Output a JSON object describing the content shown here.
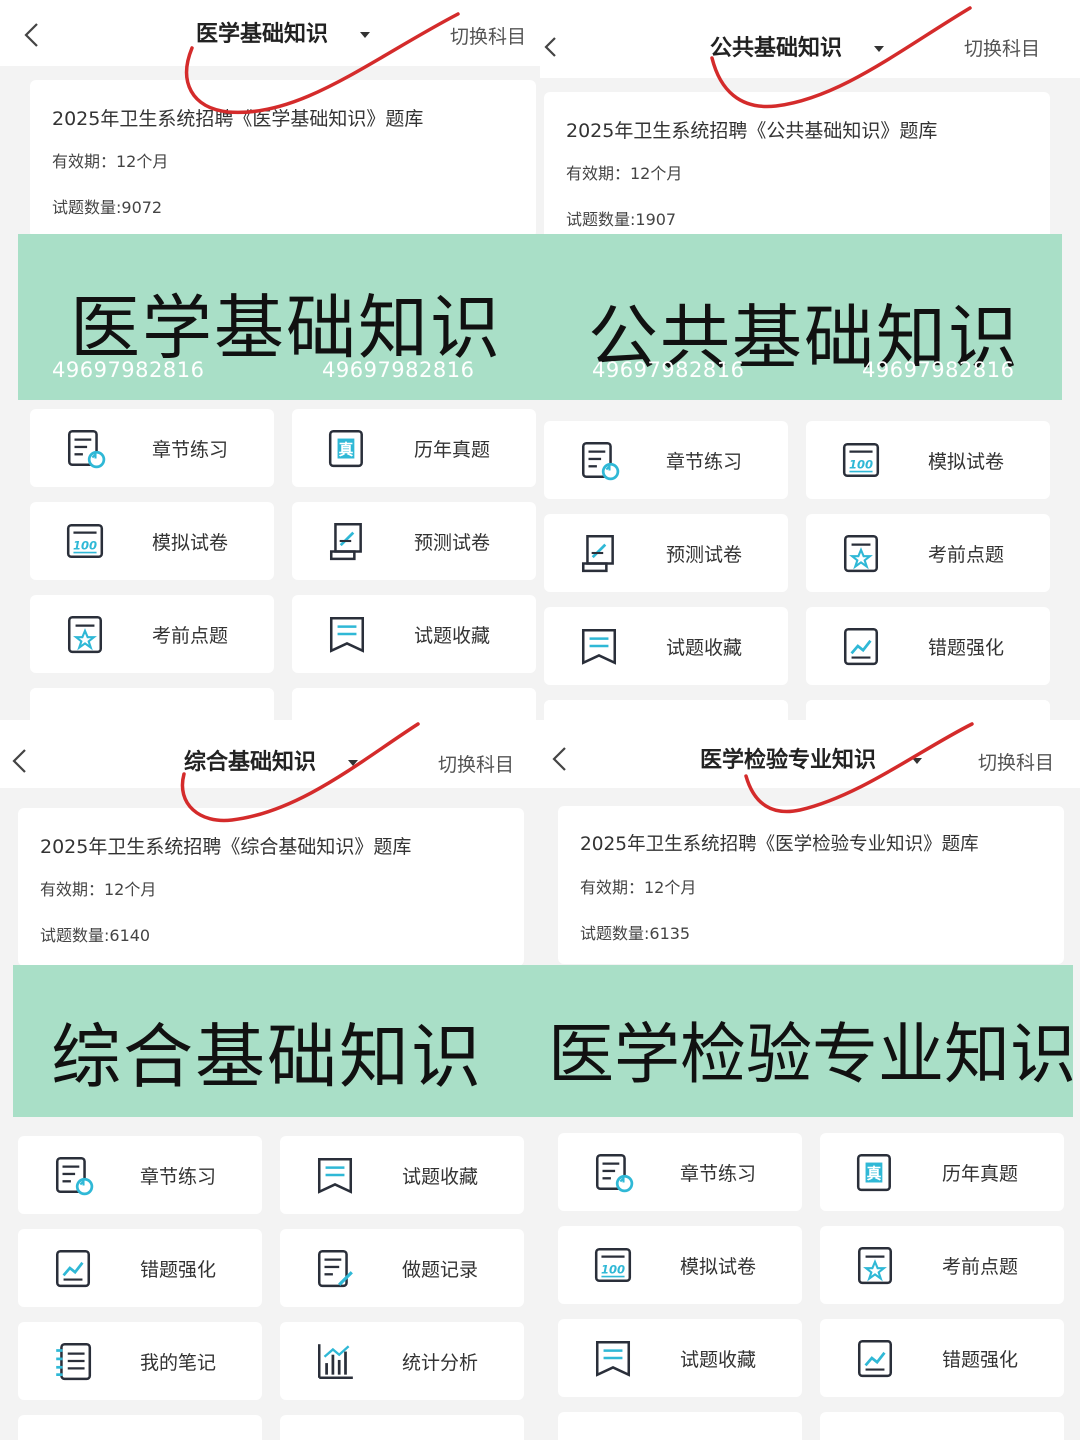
{
  "colors": {
    "banner": "#a9dfc7",
    "icon_stroke": "#2a2f3a",
    "icon_accent": "#2fb8d6",
    "annotation": "#d42b2b"
  },
  "watermark": "49697982816",
  "switch_label": "切换科目",
  "panels": [
    {
      "subject": "医学基础知识",
      "card": {
        "title": "2025年卫生系统招聘《医学基础知识》题库",
        "validity": "有效期：12个月",
        "count": "试题数量:9072"
      },
      "banner_text": "医学基础知识",
      "features": [
        {
          "label": "章节练习",
          "icon": "chapter-practice-icon"
        },
        {
          "label": "历年真题",
          "icon": "past-exams-icon"
        },
        {
          "label": "模拟试卷",
          "icon": "mock-exam-icon"
        },
        {
          "label": "预测试卷",
          "icon": "prediction-paper-icon"
        },
        {
          "label": "考前点题",
          "icon": "key-points-icon"
        },
        {
          "label": "试题收藏",
          "icon": "favorites-icon"
        }
      ]
    },
    {
      "subject": "公共基础知识",
      "card": {
        "title": "2025年卫生系统招聘《公共基础知识》题库",
        "validity": "有效期：12个月",
        "count": "试题数量:1907"
      },
      "banner_text": "公共基础知识",
      "features": [
        {
          "label": "章节练习",
          "icon": "chapter-practice-icon"
        },
        {
          "label": "模拟试卷",
          "icon": "mock-exam-icon"
        },
        {
          "label": "预测试卷",
          "icon": "prediction-paper-icon"
        },
        {
          "label": "考前点题",
          "icon": "key-points-icon"
        },
        {
          "label": "试题收藏",
          "icon": "favorites-icon"
        },
        {
          "label": "错题强化",
          "icon": "wrong-answers-icon"
        }
      ]
    },
    {
      "subject": "综合基础知识",
      "card": {
        "title": "2025年卫生系统招聘《综合基础知识》题库",
        "validity": "有效期：12个月",
        "count": "试题数量:6140"
      },
      "banner_text": "综合基础知识",
      "features": [
        {
          "label": "章节练习",
          "icon": "chapter-practice-icon"
        },
        {
          "label": "试题收藏",
          "icon": "favorites-icon"
        },
        {
          "label": "错题强化",
          "icon": "wrong-answers-icon"
        },
        {
          "label": "做题记录",
          "icon": "practice-record-icon"
        },
        {
          "label": "我的笔记",
          "icon": "notes-icon"
        },
        {
          "label": "统计分析",
          "icon": "statistics-icon"
        }
      ]
    },
    {
      "subject": "医学检验专业知识",
      "card": {
        "title": "2025年卫生系统招聘《医学检验专业知识》题库",
        "validity": "有效期：12个月",
        "count": "试题数量:6135"
      },
      "banner_text": "医学检验专业知识",
      "features": [
        {
          "label": "章节练习",
          "icon": "chapter-practice-icon"
        },
        {
          "label": "历年真题",
          "icon": "past-exams-icon"
        },
        {
          "label": "模拟试卷",
          "icon": "mock-exam-icon"
        },
        {
          "label": "考前点题",
          "icon": "key-points-icon"
        },
        {
          "label": "试题收藏",
          "icon": "favorites-icon"
        },
        {
          "label": "错题强化",
          "icon": "wrong-answers-icon"
        }
      ]
    }
  ]
}
